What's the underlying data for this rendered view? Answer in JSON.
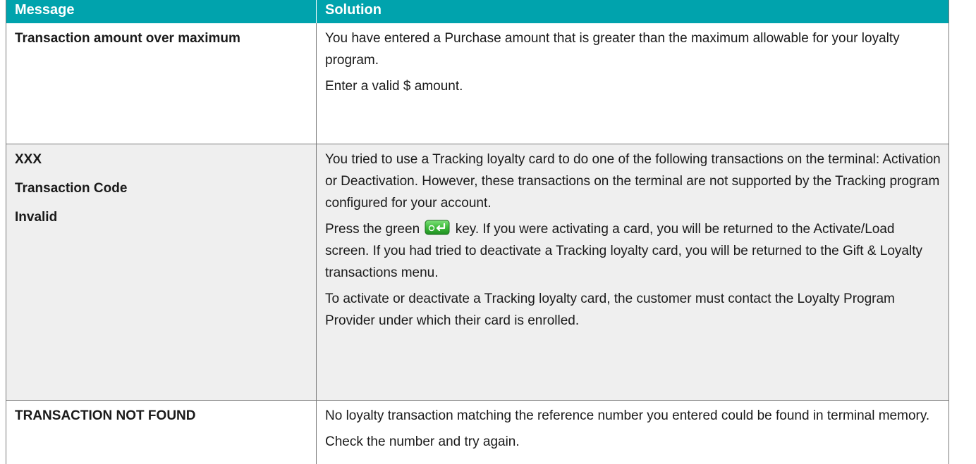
{
  "table": {
    "header": {
      "message": "Message",
      "solution": "Solution"
    },
    "rows": [
      {
        "message_lines": [
          "Transaction amount over maximum"
        ],
        "solution_paragraphs": [
          "You have entered a Purchase amount that is greater than the maximum allowable for your loyalty program.",
          "Enter a valid $ amount."
        ]
      },
      {
        "message_lines": [
          "XXX",
          "Transaction Code",
          "Invalid"
        ],
        "solution_paragraphs": [
          "You tried to use a Tracking loyalty card to do one of the following transactions on the terminal: Activation or Deactivation. However, these transactions on the terminal are not supported by the Tracking program configured for your account."
        ],
        "solution_key_paragraph": {
          "before": "Press the green",
          "after": "key. If you were activating a card, you will be returned to the Activate/Load screen. If you had tried to deactivate a Tracking loyalty card, you will be returned to the Gift & Loyalty transactions menu.",
          "key_icon": "green-ok-enter-key-icon"
        },
        "solution_paragraphs_after": [
          "To activate or deactivate a Tracking loyalty card, the customer must contact the Loyalty Program Provider under which their card is enrolled."
        ]
      },
      {
        "message_lines": [
          "TRANSACTION NOT FOUND"
        ],
        "solution_paragraphs": [
          "No loyalty transaction matching the reference number you entered could be found in terminal memory.",
          "Check the number and try again."
        ]
      }
    ]
  },
  "colors": {
    "header_bg": "#00a3ad",
    "header_text": "#ffffff",
    "alt_row_bg": "#efefef",
    "border": "#7a7a7a",
    "key_green": "#3dbb3a"
  }
}
